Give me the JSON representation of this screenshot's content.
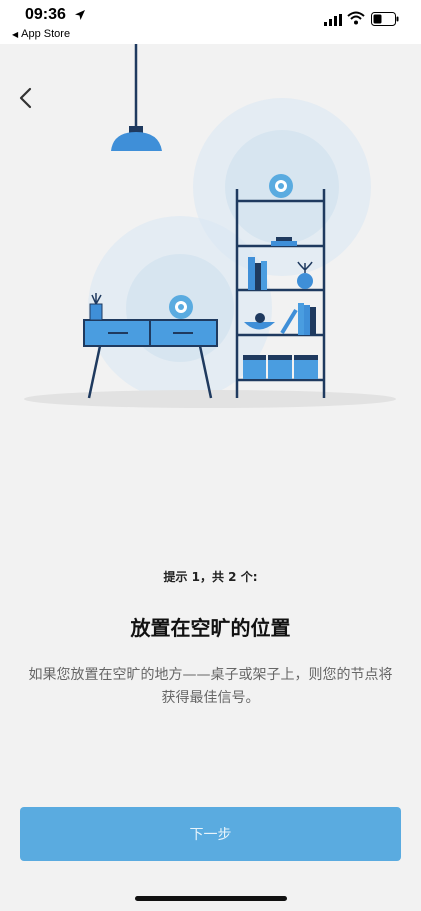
{
  "status_bar": {
    "time": "09:36",
    "back_app_label": "App Store",
    "icons": [
      "location-arrow-icon",
      "signal-icon",
      "wifi-icon",
      "battery-icon"
    ]
  },
  "nav": {
    "back_icon": "chevron-left-icon"
  },
  "content": {
    "tip": "提示 1，共 2 个:",
    "title": "放置在空旷的位置",
    "description": "如果您放置在空旷的地方——桌子或架子上，则您的节点将获得最佳信号。"
  },
  "footer": {
    "next_label": "下一步"
  },
  "colors": {
    "accent": "#5aabe0",
    "navy": "#1f3a5f",
    "blue": "#3f8fd8",
    "light_blue": "#dbe8f3",
    "background": "#f2f2f2"
  }
}
